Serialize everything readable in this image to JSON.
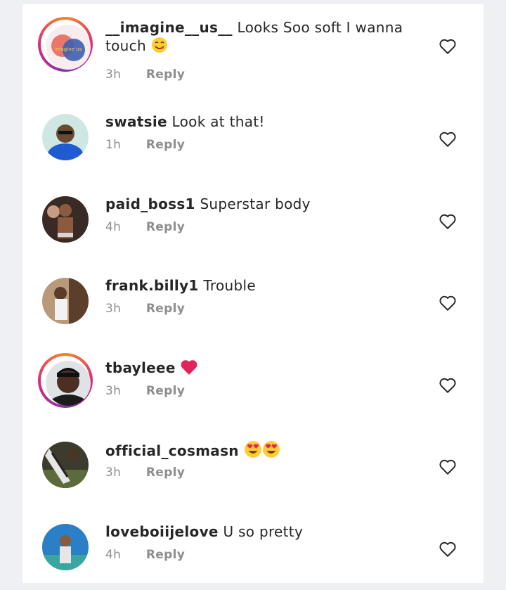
{
  "comments": [
    {
      "username": "__imagine__us__",
      "text": "Looks Soo soft I wanna",
      "text_cont": "touch",
      "time": "3h",
      "reply_label": "Reply",
      "avatar_caption": "imagine us",
      "emoji": "yum"
    },
    {
      "username": "swatsie",
      "text": "Look at that!",
      "time": "1h",
      "reply_label": "Reply"
    },
    {
      "username": "paid_boss1",
      "text": "Superstar body",
      "time": "4h",
      "reply_label": "Reply"
    },
    {
      "username": "frank.billy1",
      "text": "Trouble",
      "time": "3h",
      "reply_label": "Reply"
    },
    {
      "username": "tbayleee",
      "text": "",
      "time": "3h",
      "reply_label": "Reply",
      "emoji": "red-heart"
    },
    {
      "username": "official_cosmasn",
      "text": "",
      "time": "3h",
      "reply_label": "Reply",
      "emoji": "heart-eyes x2"
    },
    {
      "username": "loveboiijelove",
      "text": "U so pretty",
      "time": "4h",
      "reply_label": "Reply"
    }
  ],
  "colors": {
    "text": "#262626",
    "meta": "#8e8e8e",
    "background": "#eef0f3",
    "panel": "#ffffff",
    "heart_emoji": "#e0245e"
  },
  "icons": {
    "like": "heart-outline-icon"
  }
}
